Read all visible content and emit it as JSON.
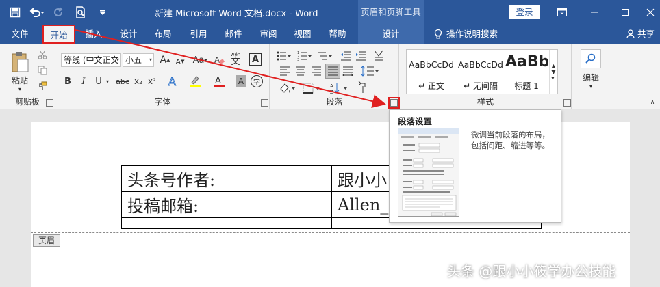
{
  "titlebar": {
    "doc_title": "新建 Microsoft Word 文档.docx  -  Word",
    "context_tab_title": "页眉和页脚工具",
    "login_label": "登录",
    "icons": [
      "save-icon",
      "undo-icon",
      "redo-icon",
      "print-preview-icon",
      "customize-qat-icon",
      "ribbon-display-icon",
      "minimize-icon",
      "maximize-icon",
      "close-icon"
    ]
  },
  "tabs": [
    "文件",
    "开始",
    "插入",
    "设计",
    "布局",
    "引用",
    "邮件",
    "审阅",
    "视图",
    "帮助",
    "设计"
  ],
  "active_tab": "开始",
  "tell_me": "操作说明搜索",
  "share_label": "共享",
  "ribbon": {
    "clipboard": {
      "paste_label": "粘贴",
      "group_label": "剪贴板"
    },
    "font": {
      "font_name": "等线 (中文正文",
      "font_size": "小五",
      "group_label": "字体",
      "wen_label": "wén",
      "wen_char": "文",
      "format_a": "A",
      "bold": "B",
      "italic": "I",
      "underline": "U",
      "strike": "abc",
      "subscript": "x₂",
      "superscript": "x²",
      "char_circle": "字"
    },
    "paragraph": {
      "group_label": "段落"
    },
    "styles": {
      "group_label": "样式",
      "items": [
        {
          "sample": "AaBbCcDd",
          "name": "↵ 正文"
        },
        {
          "sample": "AaBbCcDd",
          "name": "↵ 无间隔"
        },
        {
          "sample": "AaBb",
          "name": "标题 1"
        }
      ]
    },
    "editing": {
      "label": "编辑"
    }
  },
  "document": {
    "table": [
      [
        "头条号作者:",
        "跟小小"
      ],
      [
        "投稿邮箱:",
        "Allen_"
      ]
    ],
    "header_tag": "页眉"
  },
  "tooltip": {
    "title": "段落设置",
    "description": "微调当前段落的布局，包括间距、缩进等等。"
  },
  "watermark": "头条 @跟小小筱学办公技能",
  "colors": {
    "brand_blue": "#2b579a",
    "context_blue": "#3e6aac",
    "annotation_red": "#e02020",
    "highlight_yellow": "#ffff00",
    "font_color_red": "#e02020"
  }
}
